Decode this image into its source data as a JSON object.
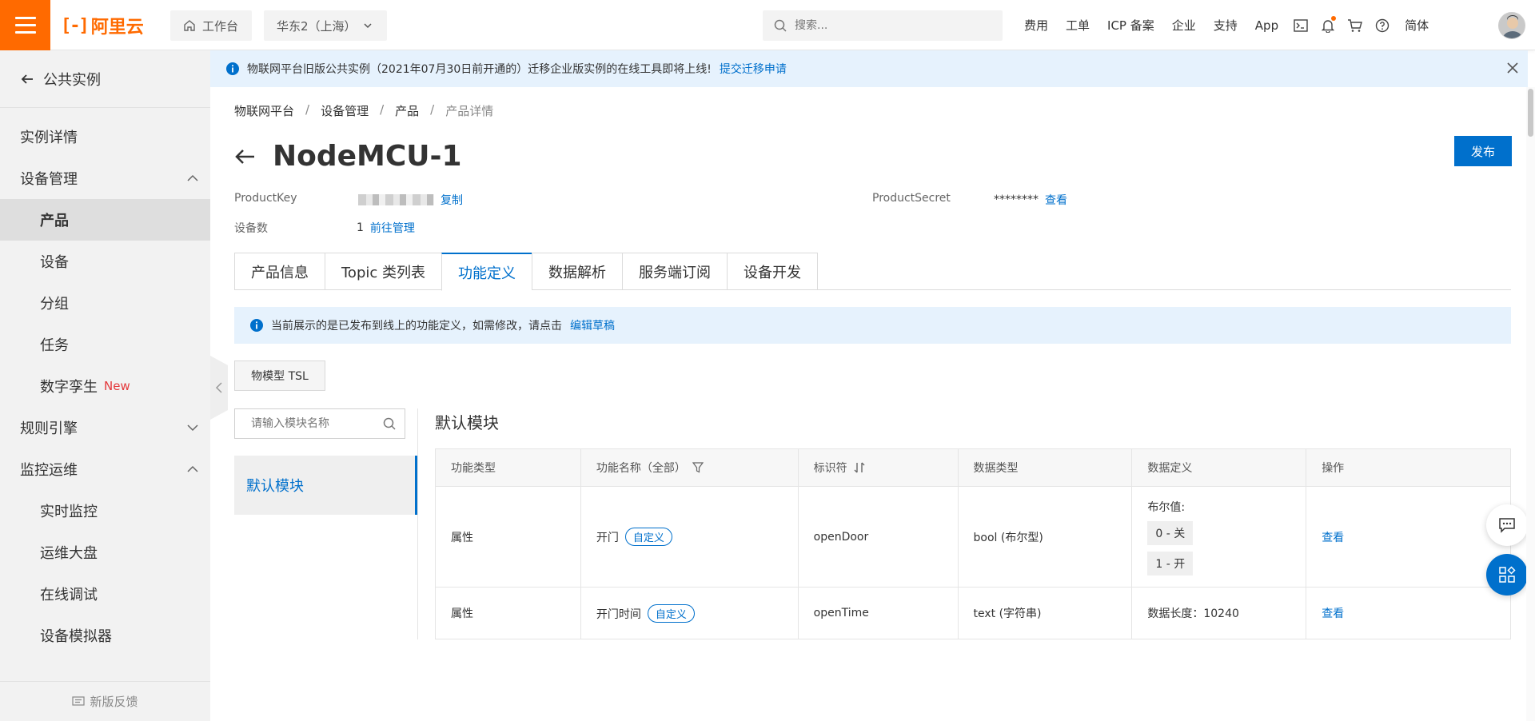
{
  "topbar": {
    "brand": "阿里云",
    "workbench_label": "工作台",
    "region_label": "华东2（上海）",
    "search_placeholder": "搜索...",
    "links": [
      "费用",
      "工单",
      "ICP 备案",
      "企业",
      "支持",
      "App"
    ],
    "lang_label": "简体",
    "accent_color": "#ff6a00"
  },
  "sidebar": {
    "back_label": "公共实例",
    "items": [
      {
        "label": "实例详情"
      },
      {
        "label": "设备管理"
      },
      {
        "label": "产品"
      },
      {
        "label": "设备"
      },
      {
        "label": "分组"
      },
      {
        "label": "任务"
      },
      {
        "label": "数字孪生",
        "badge": "New"
      },
      {
        "label": "规则引擎"
      },
      {
        "label": "监控运维"
      },
      {
        "label": "实时监控"
      },
      {
        "label": "运维大盘"
      },
      {
        "label": "在线调试"
      },
      {
        "label": "设备模拟器"
      }
    ],
    "feedback_label": "新版反馈"
  },
  "notice": {
    "text": "物联网平台旧版公共实例（2021年07月30日前开通的）迁移企业版实例的在线工具即将上线!",
    "link": "提交迁移申请"
  },
  "breadcrumb": [
    "物联网平台",
    "设备管理",
    "产品",
    "产品详情"
  ],
  "page": {
    "title": "NodeMCU-1",
    "publish_label": "发布",
    "product_key_label": "ProductKey",
    "copy_label": "复制",
    "product_secret_label": "ProductSecret",
    "product_secret_value": "********",
    "view_label": "查看",
    "device_count_label": "设备数",
    "device_count_value": "1",
    "manage_link": "前往管理"
  },
  "tabs": [
    "产品信息",
    "Topic 类列表",
    "功能定义",
    "数据解析",
    "服务端订阅",
    "设备开发"
  ],
  "info_bar": {
    "text": "当前展示的是已发布到线上的功能定义，如需修改，请点击",
    "link": "编辑草稿"
  },
  "tsl_button": "物模型 TSL",
  "module_search_placeholder": "请输入模块名称",
  "module_item": "默认模块",
  "section_title": "默认模块",
  "table": {
    "headers": [
      "功能类型",
      "功能名称（全部）",
      "标识符",
      "数据类型",
      "数据定义",
      "操作"
    ],
    "rows": [
      {
        "type": "属性",
        "name": "开门",
        "tag": "自定义",
        "identifier": "openDoor",
        "data_type": "bool (布尔型)",
        "def_title": "布尔值:",
        "def_values": [
          "0 - 关",
          "1 - 开"
        ],
        "action": "查看"
      },
      {
        "type": "属性",
        "name": "开门时间",
        "tag": "自定义",
        "identifier": "openTime",
        "data_type": "text (字符串)",
        "def_text": "数据长度：10240",
        "action": "查看"
      }
    ]
  },
  "link_color": "#0070cc"
}
